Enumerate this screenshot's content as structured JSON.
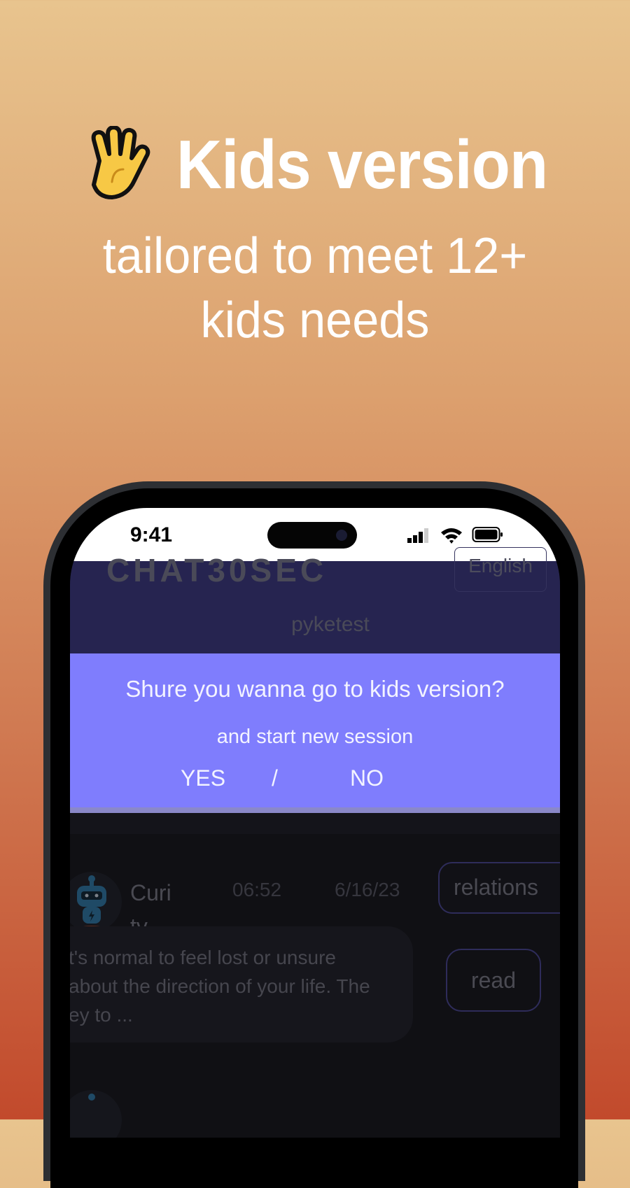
{
  "promo": {
    "title": "Kids version",
    "subtitle": "tailored to meet 12+ kids needs",
    "emoji_icon": "raised-hand-icon"
  },
  "status_bar": {
    "time": "9:41",
    "icons": [
      "signal-icon",
      "wifi-icon",
      "battery-icon"
    ]
  },
  "app_header": {
    "logo": "CHAT30SEC",
    "language": "English",
    "username": "pyketest"
  },
  "dialog": {
    "question": "Shure you wanna go to kids version?",
    "subtext": "and start new session",
    "yes_label": "YES",
    "separator": "/",
    "no_label": "NO",
    "background_color": "#7f7dfd"
  },
  "chat_list": {
    "items": [
      {
        "bot_name": "Curi tv",
        "time": "06:52",
        "date": "6/16/23",
        "tag": "relations",
        "preview": "t's normal to feel lost or unsure\nabout the direction of your life. The\ney to ...",
        "action_label": "read"
      }
    ]
  },
  "colors": {
    "background_top": "#e8c48e",
    "background_bottom": "#c24a2c",
    "header_bg": "#262450",
    "list_bg": "#101014"
  }
}
